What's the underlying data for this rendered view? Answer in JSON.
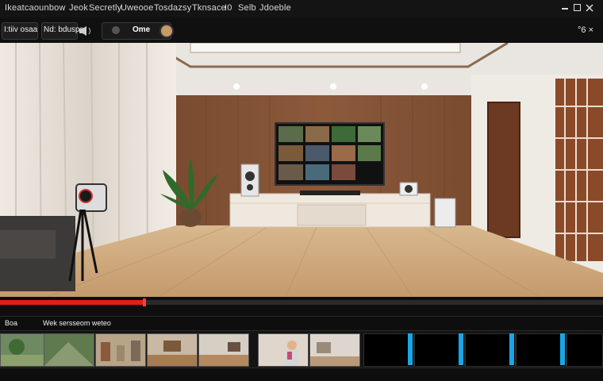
{
  "menubar": {
    "items": [
      "Ikeatcaounbow",
      "Jeok",
      "Secretly",
      "Uweooe",
      "Tosdazsy",
      "Tknsace",
      "I0",
      "Selb",
      "Jdoeble"
    ]
  },
  "toolbar": {
    "left_label_1": "I:tiiv osaa",
    "left_label_2": "Nd: bdusps",
    "mode_label": "Ome",
    "zoom_label": "°6 ×"
  },
  "timeline": {
    "progress": 0.24,
    "track_label": "Boa",
    "track_title": "Wek sersseom weteo"
  },
  "colors": {
    "accent": "#e01e1e",
    "marker": "#19a6e6",
    "record": "#c79a6a"
  }
}
